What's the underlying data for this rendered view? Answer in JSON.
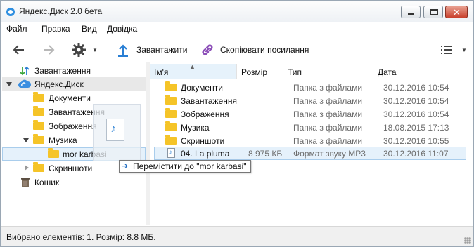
{
  "window": {
    "title": "Яндекс.Диск 2.0 бета",
    "icon": "yandex-disk-icon",
    "controls": {
      "minimize": "minimize-icon",
      "maximize": "maximize-icon",
      "close": "close-icon"
    }
  },
  "menu": [
    "Файл",
    "Правка",
    "Вид",
    "Довідка"
  ],
  "toolbar": {
    "back_icon": "arrow-left-icon",
    "forward_icon": "arrow-right-icon",
    "settings_icon": "gear-icon",
    "upload_label": "Завантажити",
    "copy_link_label": "Скопіювати посилання",
    "view_icon": "list-view-icon",
    "accent": "#2a7fd4",
    "link_color": "#8c4fb8"
  },
  "tree": {
    "items": [
      {
        "label": "Завантаження",
        "icon": "download-upload-icon"
      },
      {
        "label": "Яндекс.Диск",
        "icon": "cloud-icon"
      },
      {
        "label": "Документи"
      },
      {
        "label": "Завантаження"
      },
      {
        "label": "Зображення"
      },
      {
        "label": "Музика"
      },
      {
        "label": "mor karbasi"
      },
      {
        "label": "Скриншоти"
      },
      {
        "label": "Кошик",
        "icon": "trash-icon"
      }
    ]
  },
  "list": {
    "columns": [
      "Ім'я",
      "Розмір",
      "Тип",
      "Дата"
    ],
    "rows": [
      {
        "name": "Документи",
        "size": "",
        "type": "Папка з файлами",
        "date": "30.12.2016 10:54"
      },
      {
        "name": "Завантаження",
        "size": "",
        "type": "Папка з файлами",
        "date": "30.12.2016 10:54"
      },
      {
        "name": "Зображення",
        "size": "",
        "type": "Папка з файлами",
        "date": "30.12.2016 10:54"
      },
      {
        "name": "Музика",
        "size": "",
        "type": "Папка з файлами",
        "date": "18.08.2015 17:13"
      },
      {
        "name": "Скриншоти",
        "size": "",
        "type": "Папка з файлами",
        "date": "30.12.2016 10:55"
      },
      {
        "name": "04. La pluma",
        "size": "8 975 КБ",
        "type": "Формат звуку MP3",
        "date": "30.12.2016 11:07"
      }
    ]
  },
  "drag": {
    "tooltip": "Перемістити до \"mor karbasi\"",
    "icon": "music-file-icon"
  },
  "status": {
    "text": "Вибрано елементів: 1. Розмір: 8.8 МБ."
  }
}
